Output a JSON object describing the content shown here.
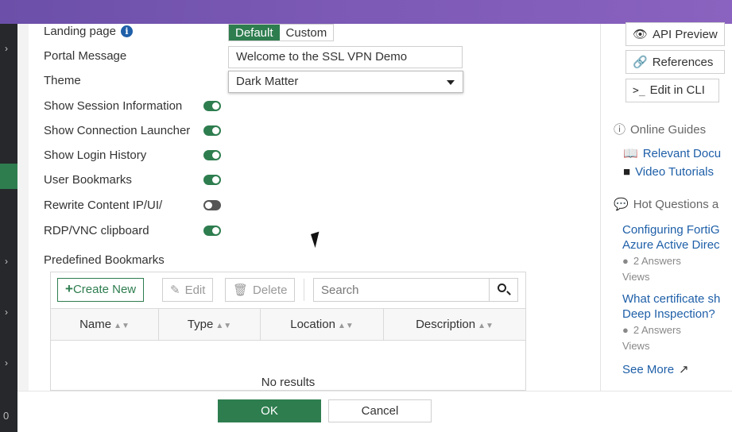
{
  "form": {
    "landing_page": {
      "label": "Landing page",
      "options": [
        "Default",
        "Custom"
      ],
      "selected": "Default"
    },
    "portal_message": {
      "label": "Portal Message",
      "value": "Welcome to the SSL VPN Demo"
    },
    "theme": {
      "label": "Theme",
      "value": "Dark Matter"
    },
    "toggles": [
      {
        "label": "Show Session Information",
        "on": true
      },
      {
        "label": "Show Connection Launcher",
        "on": true
      },
      {
        "label": "Show Login History",
        "on": true
      },
      {
        "label": "User Bookmarks",
        "on": true
      },
      {
        "label": "Rewrite Content IP/UI/",
        "on": false
      },
      {
        "label": "RDP/VNC clipboard",
        "on": true
      }
    ]
  },
  "bookmarks": {
    "title": "Predefined Bookmarks",
    "toolbar": {
      "create": "Create New",
      "edit": "Edit",
      "delete": "Delete",
      "search_placeholder": "Search"
    },
    "columns": [
      "Name",
      "Type",
      "Location",
      "Description"
    ],
    "empty_text": "No results"
  },
  "footer": {
    "ok": "OK",
    "cancel": "Cancel"
  },
  "right_panel": {
    "api_preview": "API Preview",
    "references": "References",
    "edit_cli": "Edit in CLI",
    "online_guides": "Online Guides",
    "relevant_docs": "Relevant Docu",
    "video_tutorials": "Video Tutorials",
    "hot_questions": "Hot Questions a",
    "q1_line1": "Configuring FortiG",
    "q1_line2": "Azure Active Direc",
    "q1_answers": "2 Answers",
    "q1_views": "Views",
    "q2_line1": "What certificate sh",
    "q2_line2": "Deep Inspection?",
    "q2_answers": "2 Answers",
    "q2_views": "Views",
    "see_more": "See More"
  },
  "left_strip": {
    "badge": "0"
  },
  "colors": {
    "accent": "#2e7d4f",
    "topbar": "#7b59b5",
    "link": "#1e5fa8"
  }
}
